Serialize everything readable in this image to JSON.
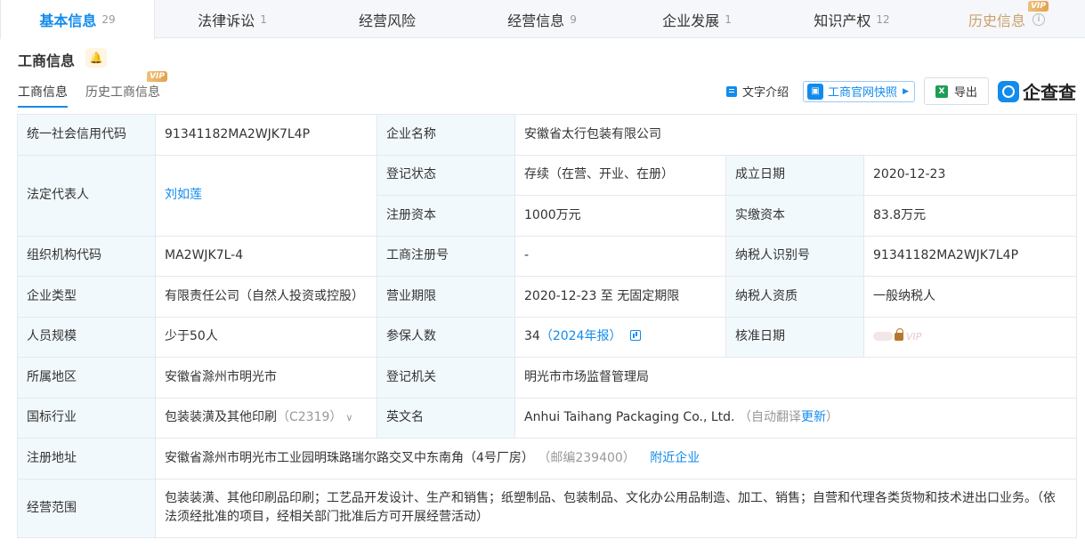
{
  "tabs": [
    {
      "label": "基本信息",
      "count": "29"
    },
    {
      "label": "法律诉讼",
      "count": "1"
    },
    {
      "label": "经营风险",
      "count": ""
    },
    {
      "label": "经营信息",
      "count": "9"
    },
    {
      "label": "企业发展",
      "count": "1"
    },
    {
      "label": "知识产权",
      "count": "12"
    },
    {
      "label": "历史信息",
      "count": "",
      "vip": "VIP"
    }
  ],
  "section": {
    "title": "工商信息",
    "subtabs": [
      {
        "label": "工商信息"
      },
      {
        "label": "历史工商信息",
        "vip": "VIP"
      }
    ]
  },
  "toolbar": {
    "text_intro": "文字介绍",
    "snapshot": "工商官网快照",
    "export": "导出",
    "brand": "企查查",
    "xls_icon_text": "X"
  },
  "rows": {
    "credit_code_label": "统一社会信用代码",
    "credit_code": "91341182MA2WJK7L4P",
    "company_name_label": "企业名称",
    "company_name": "安徽省太行包装有限公司",
    "legal_rep_label": "法定代表人",
    "legal_rep": "刘如莲",
    "reg_status_label": "登记状态",
    "reg_status": "存续（在营、开业、在册）",
    "found_date_label": "成立日期",
    "found_date": "2020-12-23",
    "reg_capital_label": "注册资本",
    "reg_capital": "1000万元",
    "paid_capital_label": "实缴资本",
    "paid_capital": "83.8万元",
    "org_code_label": "组织机构代码",
    "org_code": "MA2WJK7L-4",
    "biz_reg_no_label": "工商注册号",
    "biz_reg_no": "-",
    "taxpayer_id_label": "纳税人识别号",
    "taxpayer_id": "91341182MA2WJK7L4P",
    "company_type_label": "企业类型",
    "company_type": "有限责任公司（自然人投资或控股）",
    "biz_term_label": "营业期限",
    "biz_term": "2020-12-23 至 无固定期限",
    "taxpayer_qual_label": "纳税人资质",
    "taxpayer_qual": "一般纳税人",
    "staff_size_label": "人员规模",
    "staff_size": "少于50人",
    "insured_label": "参保人数",
    "insured": "34",
    "insured_year": "（2024年报）",
    "approve_date_label": "核准日期",
    "approve_vip": "VIP",
    "region_label": "所属地区",
    "region": "安徽省滁州市明光市",
    "reg_authority_label": "登记机关",
    "reg_authority": "明光市市场监督管理局",
    "industry_label": "国标行业",
    "industry": "包装装潢及其他印刷",
    "industry_code": "（C2319）",
    "english_name_label": "英文名",
    "english_name": "Anhui Taihang Packaging Co., Ltd.",
    "auto_translate": "（自动翻译",
    "update": "更新",
    "auto_translate_end": "）",
    "address_label": "注册地址",
    "address": "安徽省滁州市明光市工业园明珠路瑞尔路交叉中东南角（4号厂房）",
    "postcode": "（邮编239400）",
    "nearby": "附近企业",
    "scope_label": "经营范围",
    "scope": "包装装潢、其他印刷品印刷；工艺品开发设计、生产和销售；纸塑制品、包装制品、文化办公用品制造、加工、销售；自营和代理各类货物和技术进出口业务。（依法须经批准的项目，经相关部门批准后方可开展经营活动）"
  }
}
